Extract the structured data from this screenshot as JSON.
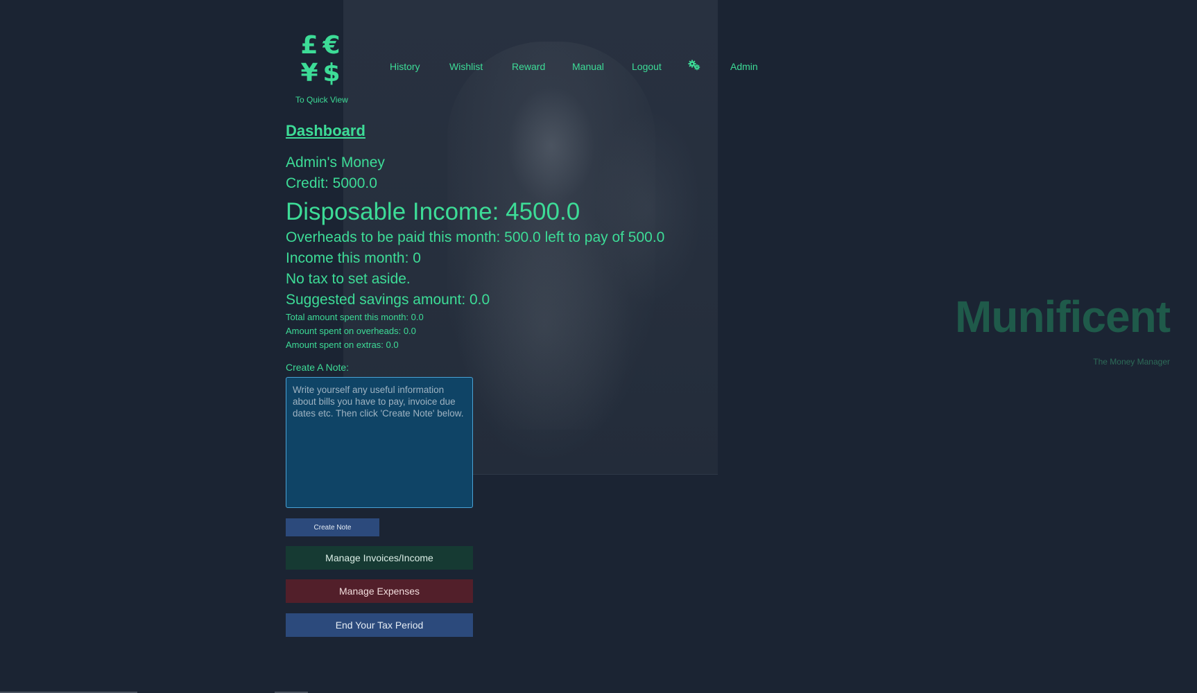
{
  "header": {
    "logo_symbols": [
      "£",
      "€",
      "¥",
      "$"
    ],
    "quick_view_link": "To Quick View",
    "nav": [
      {
        "label": "History",
        "name": "nav-history"
      },
      {
        "label": "Wishlist",
        "name": "nav-wishlist"
      },
      {
        "label": "Reward",
        "name": "nav-reward"
      },
      {
        "label": "Manual",
        "name": "nav-manual"
      },
      {
        "label": "Logout",
        "name": "nav-logout"
      },
      {
        "label": "",
        "name": "nav-settings",
        "icon": "gears-icon"
      },
      {
        "label": "Admin",
        "name": "nav-admin"
      }
    ]
  },
  "dashboard": {
    "title": "Dashboard",
    "owner_money": "Admin's Money",
    "credit": "Credit: 5000.0",
    "disposable_income": "Disposable Income: 4500.0",
    "overheads": "Overheads to be paid this month: 500.0 left to pay of 500.0",
    "income_month": "Income this month: 0",
    "tax": "No tax to set aside.",
    "savings": "Suggested savings amount: 0.0",
    "total_spent": "Total amount spent this month: 0.0",
    "spent_overheads": "Amount spent on overheads: 0.0",
    "spent_extras": "Amount spent on extras: 0.0"
  },
  "note": {
    "label": "Create A Note:",
    "placeholder": "Write yourself any useful information about bills you have to pay, invoice due dates etc. Then click 'Create Note' below.",
    "button": "Create Note"
  },
  "actions": {
    "invoices": "Manage Invoices/Income",
    "expenses": "Manage Expenses",
    "tax_period": "End Your Tax Period"
  },
  "brand": {
    "name": "Munificent",
    "tagline": "The Money Manager"
  },
  "colors": {
    "background": "#1b2433",
    "accent": "#3ddc97",
    "invoices_button": "#163a33",
    "expenses_button": "#521f2a",
    "tax_button": "#2c4a7c"
  }
}
